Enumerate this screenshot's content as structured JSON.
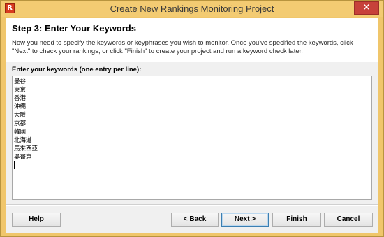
{
  "window": {
    "title": "Create New Rankings Monitoring Project",
    "close_glyph": "✕",
    "app_icon_glyph": "R"
  },
  "header": {
    "step_title": "Step 3: Enter Your Keywords",
    "description": "Now you need to specify the keywords or keyphrases you wish to monitor. Once you've specified the keywords, click \"Next\" to check your rankings, or click \"Finish\" to create your project and run a keyword check later."
  },
  "keywords": {
    "label": "Enter your keywords (one entry per line):",
    "entries": [
      "曼谷",
      "東京",
      "香港",
      "沖繩",
      "大阪",
      "京都",
      "韓國",
      "北海道",
      "馬來西亞",
      "吳哥窟"
    ]
  },
  "buttons": {
    "help": "Help",
    "back_prefix": "< ",
    "back_access": "B",
    "back_rest": "ack",
    "next_access": "N",
    "next_rest": "ext >",
    "finish_access": "F",
    "finish_rest": "inish",
    "cancel": "Cancel"
  },
  "colors": {
    "window_frame": "#f0c66b",
    "close_button": "#c7413a",
    "client_background": "#f0f0f0"
  }
}
